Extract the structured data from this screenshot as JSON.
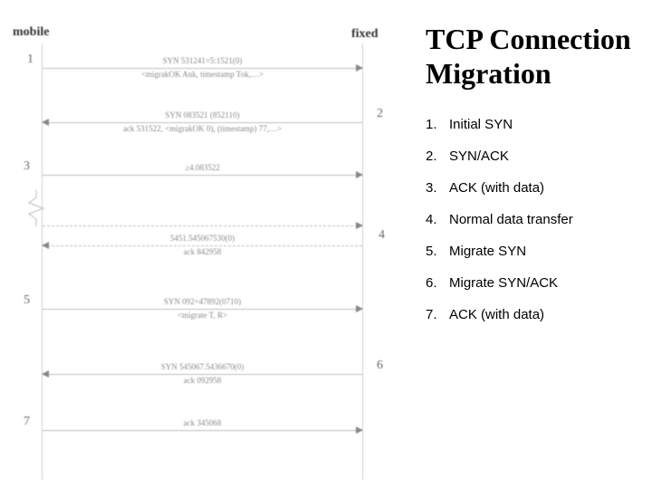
{
  "title": "TCP Connection Migration",
  "steps": [
    {
      "num": "1.",
      "txt": "Initial SYN"
    },
    {
      "num": "2.",
      "txt": "SYN/ACK"
    },
    {
      "num": "3.",
      "txt": "ACK (with data)"
    },
    {
      "num": "4.",
      "txt": "Normal data transfer"
    },
    {
      "num": "5.",
      "txt": "Migrate SYN"
    },
    {
      "num": "6.",
      "txt": "Migrate SYN/ACK"
    },
    {
      "num": "7.",
      "txt": "ACK (with data)"
    }
  ],
  "diagram": {
    "left_label": "mobile",
    "right_label": "fixed",
    "messages": {
      "m1": {
        "num": "1",
        "top": "SYN 531241=5:1521(0)",
        "bot": "<migrakOK Ank, timestamp Tok,…>"
      },
      "m2": {
        "num": "2",
        "top": "SYN 083521 (852110)",
        "bot": "ack 531522, <migrakOK 0), (timestamp) 77,…>"
      },
      "m3": {
        "num": "3",
        "top": "≥4.083522"
      },
      "m4": {
        "num": "4",
        "top": "5451.545067530(0)",
        "bot": "ack 842958"
      },
      "m5": {
        "num": "5",
        "top": "SYN 092=47892(0710)",
        "bot": "<migrate T, R>"
      },
      "m6": {
        "num": "6",
        "top": "SYN 545067.5436670(0)",
        "bot": "ack 092958"
      },
      "m7": {
        "num": "7",
        "top": "ack 345068"
      }
    }
  }
}
